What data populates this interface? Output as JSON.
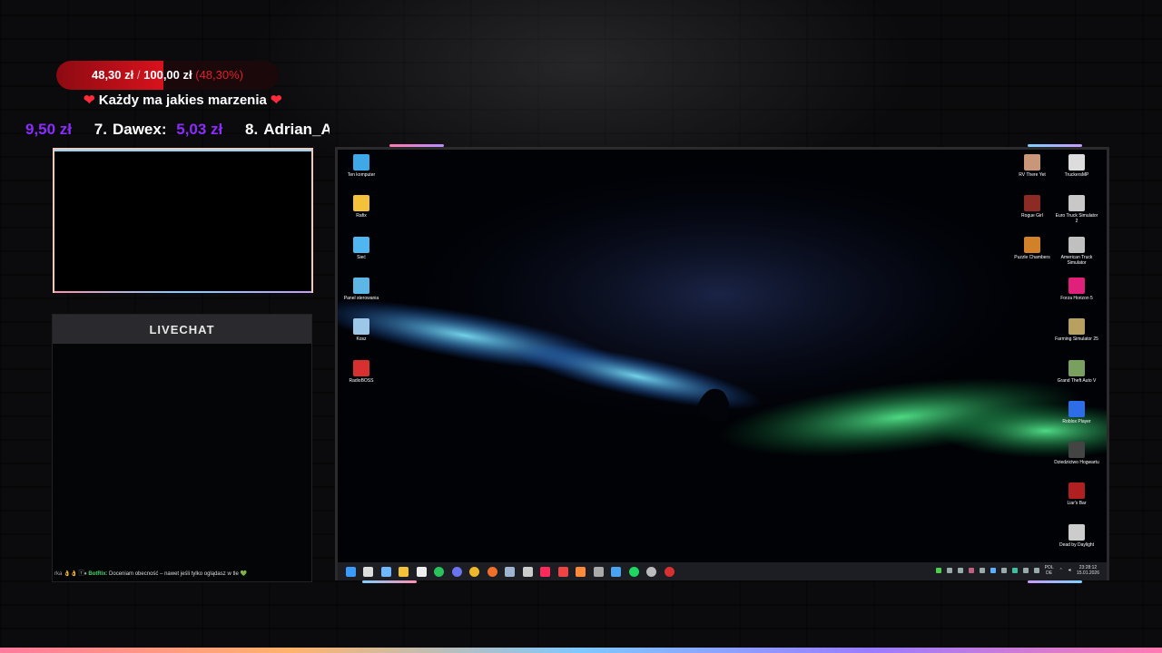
{
  "goal": {
    "current": "48,30 zł",
    "separator": "/",
    "target": "100,00 zł",
    "percent_text": "(48,30%)",
    "progress": 0.483,
    "message": "Każdy ma jakies marzenia"
  },
  "ticker": [
    {
      "rank": "",
      "name": "",
      "amount": "9,50 zł"
    },
    {
      "rank": "7.",
      "name": "Dawex:",
      "amount": "5,03 zł"
    },
    {
      "rank": "8.",
      "name": "Adrian_ASS",
      "amount": ""
    }
  ],
  "livechat": {
    "title": "LIVECHAT",
    "message_prefix": "rka 👌👌 🅃♦",
    "message_user": "BotRix",
    "message_text": ": Doceniam obecność – nawet jeśli tylko oglądasz w tle 💚"
  },
  "desktop": {
    "left_icons": [
      {
        "label": "Ten komputer",
        "icon": "computer-icon",
        "color": "#3ea8e8"
      },
      {
        "label": "Rafix",
        "icon": "folder-icon",
        "color": "#f3c13a"
      },
      {
        "label": "Sieć",
        "icon": "network-icon",
        "color": "#4fb6f0"
      },
      {
        "label": "Panel sterowania",
        "icon": "control-panel-icon",
        "color": "#5cb7e6"
      },
      {
        "label": "Kosz",
        "icon": "recycle-bin-icon",
        "color": "#9cc7e8"
      },
      {
        "label": "RadioBOSS",
        "icon": "radioboss-icon",
        "color": "#d83030"
      }
    ],
    "right_icons": [
      [
        {
          "label": "RV There Yet",
          "icon": "rv-there-yet-icon",
          "color": "#c9967a"
        },
        {
          "label": "TruckersMP",
          "icon": "truckersmp-icon",
          "color": "#dddddd"
        }
      ],
      [
        {
          "label": "Rogue Girl",
          "icon": "rogue-girl-icon",
          "color": "#8c2a24"
        },
        {
          "label": "Euro Truck Simulator 2",
          "icon": "euro-truck-icon",
          "color": "#c8c8c8"
        }
      ],
      [
        {
          "label": "Puzzle Chambers",
          "icon": "puzzle-chambers-icon",
          "color": "#d0812a"
        },
        {
          "label": "American Truck Simulator",
          "icon": "american-truck-icon",
          "color": "#c0c0c0"
        }
      ],
      [
        {
          "label": "",
          "icon": "",
          "color": ""
        },
        {
          "label": "Forza Horizon 5",
          "icon": "forza-horizon-icon",
          "color": "#e0207a"
        }
      ],
      [
        {
          "label": "",
          "icon": "",
          "color": ""
        },
        {
          "label": "Farming Simulator 25",
          "icon": "farming-simulator-icon",
          "color": "#b8a060"
        }
      ],
      [
        {
          "label": "",
          "icon": "",
          "color": ""
        },
        {
          "label": "Grand Theft Auto V",
          "icon": "gta-v-icon",
          "color": "#7aa060"
        }
      ],
      [
        {
          "label": "",
          "icon": "",
          "color": ""
        },
        {
          "label": "Roblox Player",
          "icon": "roblox-icon",
          "color": "#2d6ee8"
        }
      ],
      [
        {
          "label": "",
          "icon": "",
          "color": ""
        },
        {
          "label": "Dziedzictwo Hogwartu",
          "icon": "hogwarts-legacy-icon",
          "color": "#444444"
        }
      ],
      [
        {
          "label": "",
          "icon": "",
          "color": ""
        },
        {
          "label": "Liar's Bar",
          "icon": "liars-bar-icon",
          "color": "#b02020"
        }
      ],
      [
        {
          "label": "",
          "icon": "",
          "color": ""
        },
        {
          "label": "Dead by Daylight",
          "icon": "dead-by-daylight-icon",
          "color": "#cccccc"
        }
      ]
    ],
    "taskbar_icons": [
      {
        "icon": "windows-start-icon",
        "color": "#3b9cff"
      },
      {
        "icon": "search-icon",
        "color": "#dddddd"
      },
      {
        "icon": "task-view-icon",
        "color": "#6fb8ff"
      },
      {
        "icon": "file-explorer-icon",
        "color": "#f2c23a"
      },
      {
        "icon": "calendar-icon",
        "color": "#eeeeee"
      },
      {
        "icon": "whatsapp-icon",
        "color": "#29c25b"
      },
      {
        "icon": "discord-icon",
        "color": "#6a74f0"
      },
      {
        "icon": "chrome-icon",
        "color": "#f0b62a"
      },
      {
        "icon": "firefox-icon",
        "color": "#f0702a"
      },
      {
        "icon": "steam-icon",
        "color": "#9fb4d0"
      },
      {
        "icon": "obs-icon",
        "color": "#cccccc"
      },
      {
        "icon": "tiktok-icon",
        "color": "#ff2a5a"
      },
      {
        "icon": "tf-app-icon",
        "color": "#ee4444"
      },
      {
        "icon": "adobe-icon",
        "color": "#ff8a3a"
      },
      {
        "icon": "camera-icon",
        "color": "#aaaaaa"
      },
      {
        "icon": "photos-icon",
        "color": "#4aa3f0"
      },
      {
        "icon": "spotify-icon",
        "color": "#1ed760"
      },
      {
        "icon": "settings-icon",
        "color": "#bbbbbb"
      },
      {
        "icon": "radioboss-taskbar-icon",
        "color": "#d83030"
      }
    ],
    "tray": {
      "lang_top": "POL",
      "lang_bottom": "DE",
      "time": "23:28:12",
      "date": "15.01.2026"
    }
  },
  "colors": {
    "goal_red": "#d8121c",
    "ticker_amount": "#8b2cff",
    "chat_user": "#43d36b"
  }
}
